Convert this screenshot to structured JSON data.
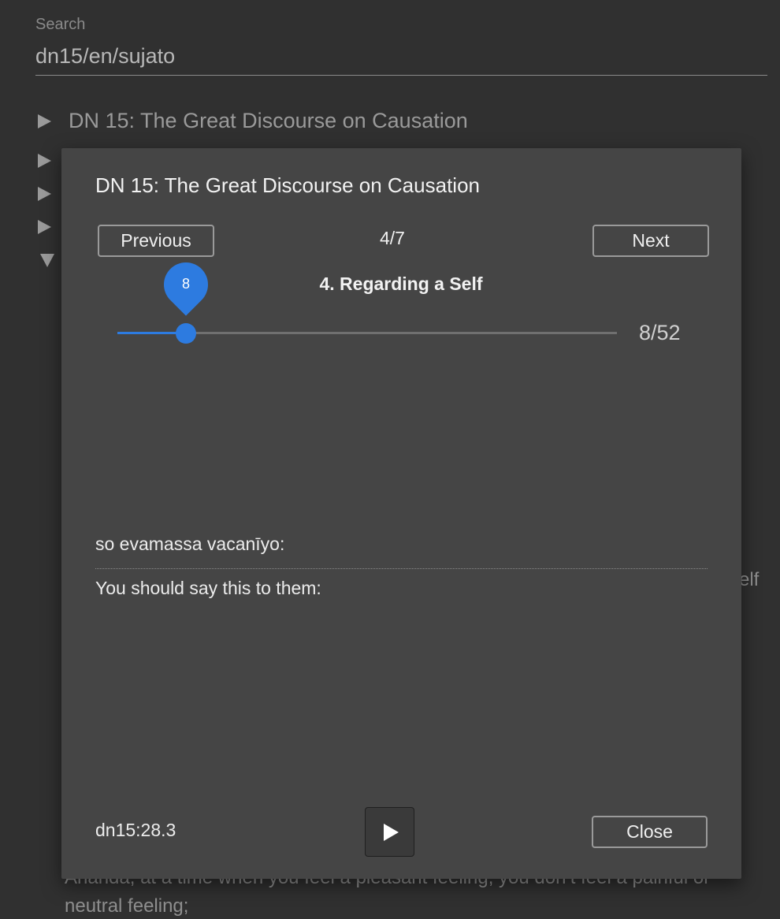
{
  "search": {
    "label": "Search",
    "value": "dn15/en/sujato"
  },
  "background": {
    "tree": [
      {
        "label": "DN 15: The Great Discourse on Causation",
        "expanded": false
      },
      {
        "label": "",
        "expanded": false
      },
      {
        "label": "",
        "expanded": false
      },
      {
        "label": "",
        "expanded": false
      },
      {
        "label": "",
        "expanded": true
      }
    ],
    "peek_text": "elf",
    "bottom_lines": [
      "Ānanda, at a time when you feel a pleasant feeling, you don’t feel a painful or",
      "neutral feeling;"
    ]
  },
  "dialog": {
    "title": "DN 15: The Great Discourse on Causation",
    "previous_label": "Previous",
    "next_label": "Next",
    "section_counter": "4/7",
    "section_title": "4. Regarding a Self",
    "slider": {
      "value": 8,
      "max": 52,
      "bubble": "8",
      "count_text": "8/52",
      "accent_color": "#2d7be0"
    },
    "pali_text": "so evamassa vacanīyo:",
    "english_text": "You should say this to them:",
    "segment_id": "dn15:28.3",
    "play_icon": "play-icon",
    "close_label": "Close"
  }
}
